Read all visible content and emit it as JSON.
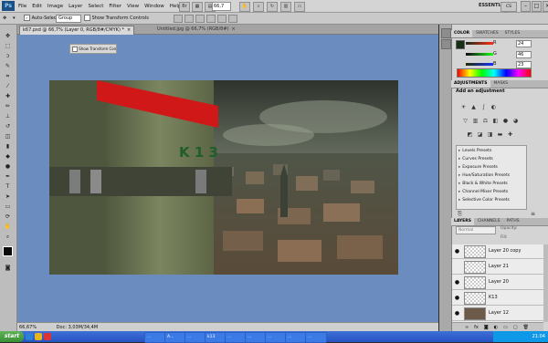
{
  "menubar": {
    "logo": "Ps",
    "menus": [
      "File",
      "Edit",
      "Image",
      "Layer",
      "Select",
      "Filter",
      "View",
      "Window",
      "Help"
    ],
    "zoom": "66,7",
    "workspace": "ESSENTIALS",
    "cs_live": "CS Live"
  },
  "options": {
    "auto_select_label": "Auto-Select:",
    "auto_select_value": "Group",
    "show_transform_label": "Show Transform Controls"
  },
  "tabs": [
    {
      "label": "k67.psd @ 66,7% (Layer 0, RGB/8#/CMYK) *",
      "close": "×"
    },
    {
      "label": "Untitled.jpg @ 66,7% (RGB/8#)",
      "close": "×"
    }
  ],
  "floating_tip": "Show Transform Con",
  "photo": {
    "sign_text": "K 1 3",
    "stripe_color": "#d01818"
  },
  "status": {
    "zoom": "66,67%",
    "doc": "Doc: 3,03M/34,4M"
  },
  "color_panel": {
    "tabs": [
      "COLOR",
      "SWATCHES",
      "STYLES"
    ],
    "channels": [
      {
        "label": "R",
        "value": "24"
      },
      {
        "label": "G",
        "value": "46"
      },
      {
        "label": "B",
        "value": "23"
      }
    ]
  },
  "adjustments": {
    "tabs": [
      "ADJUSTMENTS",
      "MASKS"
    ],
    "title": "Add an adjustment",
    "presets": [
      "Levels Presets",
      "Curves Presets",
      "Exposure Presets",
      "Hue/Saturation Presets",
      "Black & White Presets",
      "Channel Mixer Presets",
      "Selective Color Presets"
    ]
  },
  "layers_panel": {
    "tabs": [
      "LAYERS",
      "CHANNELS",
      "PATHS"
    ],
    "blend": "Normal",
    "opacity_label": "Opacity:",
    "fill_label": "Fill:",
    "layers": [
      {
        "name": "Layer 20 copy",
        "visible": true,
        "selected": false
      },
      {
        "name": "Layer 21",
        "visible": false,
        "selected": false
      },
      {
        "name": "Layer 20",
        "visible": true,
        "selected": false
      },
      {
        "name": "K13",
        "visible": true,
        "selected": false
      },
      {
        "name": "Layer 12",
        "visible": true,
        "selected": false
      }
    ]
  },
  "taskbar": {
    "start": "start",
    "buttons": [
      "...",
      "A...",
      "...",
      "k13",
      "...",
      "...",
      "...",
      "...",
      "..."
    ],
    "clock": "21:04"
  }
}
